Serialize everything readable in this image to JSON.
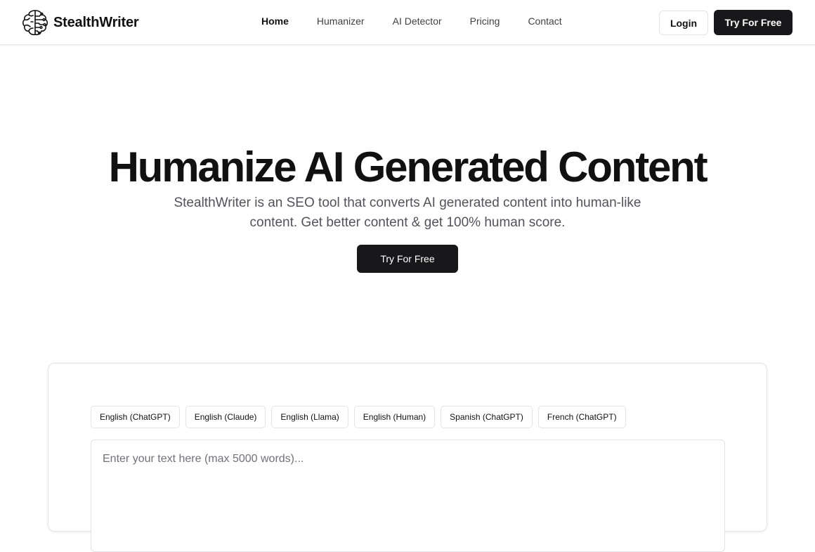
{
  "nav": {
    "brand_name": "StealthWriter",
    "logo_icon": "brain-circuit-icon",
    "links": [
      {
        "label": "Home",
        "active": true
      },
      {
        "label": "Humanizer",
        "active": false
      },
      {
        "label": "AI Detector",
        "active": false
      },
      {
        "label": "Pricing",
        "active": false
      },
      {
        "label": "Contact",
        "active": false
      }
    ],
    "login_label": "Login",
    "try_label": "Try For Free"
  },
  "hero": {
    "title": "Humanize AI Generated Content",
    "subtitle": "StealthWriter is an SEO tool that converts AI generated content into human-like content. Get better content & get 100% human score.",
    "cta_label": "Try For Free"
  },
  "tool": {
    "tabs": [
      {
        "label": "English (ChatGPT)"
      },
      {
        "label": "English (Claude)"
      },
      {
        "label": "English (Llama)"
      },
      {
        "label": "English (Human)"
      },
      {
        "label": "Spanish (ChatGPT)"
      },
      {
        "label": "French (ChatGPT)"
      }
    ],
    "input_placeholder": "Enter your text here (max 5000 words)...",
    "input_value": ""
  },
  "colors": {
    "primary_dark": "#18181b",
    "border": "#e4e4e7",
    "muted_text": "#52525b"
  }
}
